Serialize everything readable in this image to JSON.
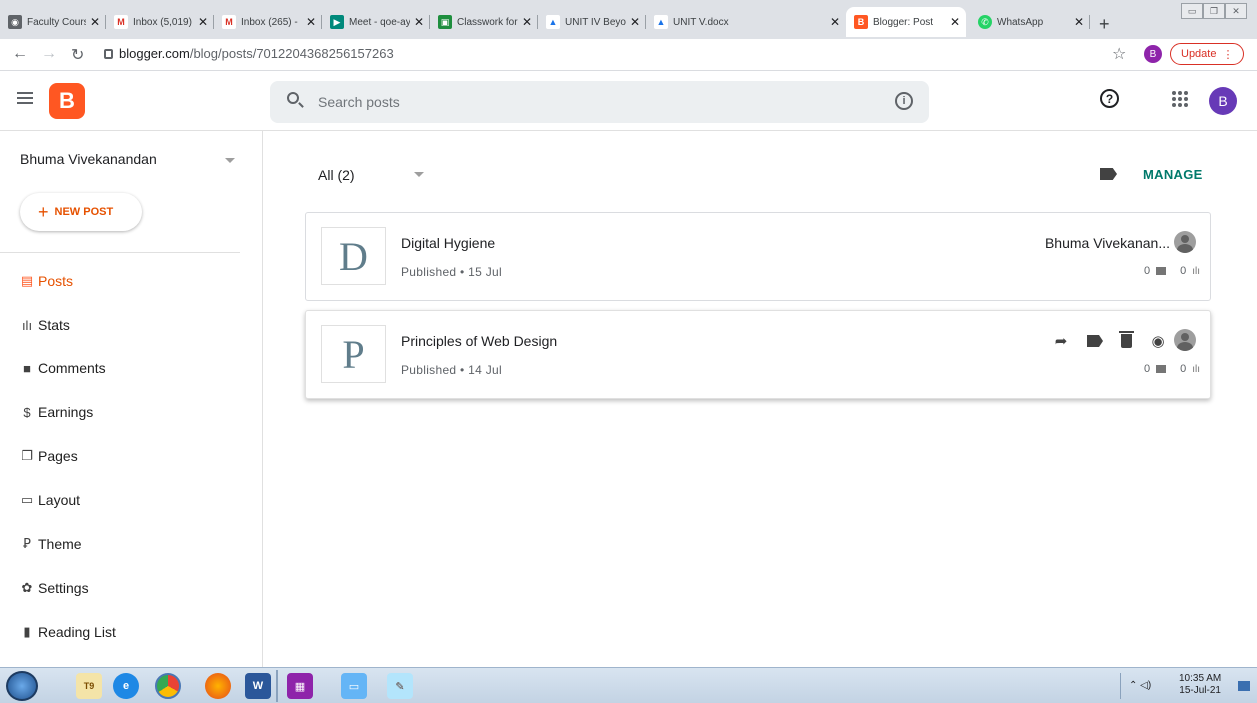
{
  "browser": {
    "tabs": [
      {
        "title": "Faculty Cours",
        "favicon": "globe-icon",
        "color": "#5f6368",
        "glyph": "◉"
      },
      {
        "title": "Inbox (5,019)",
        "favicon": "gmail-icon",
        "color": "#d93025",
        "glyph": "M"
      },
      {
        "title": "Inbox (265) -",
        "favicon": "gmail-icon",
        "color": "#d93025",
        "glyph": "M"
      },
      {
        "title": "Meet - qoe-ay",
        "favicon": "meet-icon",
        "color": "#00897b",
        "glyph": "▶"
      },
      {
        "title": "Classwork for",
        "favicon": "classroom-icon",
        "color": "#1e8e3e",
        "glyph": "▣"
      },
      {
        "title": "UNIT IV Beyon",
        "favicon": "drive-icon",
        "color": "#1a73e8",
        "glyph": "▲"
      },
      {
        "title": "UNIT V.docx",
        "favicon": "drive-icon",
        "color": "#1a73e8",
        "glyph": "▲"
      },
      {
        "title": "Blogger: Post",
        "favicon": "blogger-icon",
        "color": "#ff5722",
        "glyph": "B"
      },
      {
        "title": "WhatsApp",
        "favicon": "whatsapp-icon",
        "color": "#25d366",
        "glyph": "✆"
      }
    ],
    "active_tab": 7,
    "new_tab": "+",
    "url_host": "blogger.com",
    "url_path": "/blog/posts/7012204368256157263",
    "profile_letter": "B",
    "update_label": "Update"
  },
  "header": {
    "logo_letter": "B",
    "search_placeholder": "Search posts",
    "avatar_letter": "B"
  },
  "sidebar": {
    "blog_name": "Bhuma Vivekanandan",
    "new_post_label": "NEW POST",
    "items": [
      {
        "label": "Posts",
        "icon": "posts-icon",
        "glyph": "▤"
      },
      {
        "label": "Stats",
        "icon": "stats-icon",
        "glyph": "ılı"
      },
      {
        "label": "Comments",
        "icon": "comments-icon",
        "glyph": "■"
      },
      {
        "label": "Earnings",
        "icon": "earnings-icon",
        "glyph": "$"
      },
      {
        "label": "Pages",
        "icon": "pages-icon",
        "glyph": "❐"
      },
      {
        "label": "Layout",
        "icon": "layout-icon",
        "glyph": "▭"
      },
      {
        "label": "Theme",
        "icon": "theme-icon",
        "glyph": "Ꝑ"
      },
      {
        "label": "Settings",
        "icon": "settings-icon",
        "glyph": "✿"
      },
      {
        "label": "Reading List",
        "icon": "reading-list-icon",
        "glyph": "▮"
      }
    ]
  },
  "main": {
    "filter_label": "All (2)",
    "manage_label": "MANAGE",
    "posts": [
      {
        "letter": "D",
        "title": "Digital Hygiene",
        "meta": "Published • 15 Jul",
        "author": "Bhuma Vivekanan...",
        "comments": "0",
        "views": "0"
      },
      {
        "letter": "P",
        "title": "Principles of Web Design",
        "meta": "Published • 14 Jul",
        "author": "",
        "comments": "0",
        "views": "0"
      }
    ]
  },
  "taskbar": {
    "time": "10:35 AM",
    "date": "15-Jul-21"
  },
  "colors": {
    "brand": "#ff5722",
    "accent_text": "#e65100",
    "manage": "#00796b"
  }
}
